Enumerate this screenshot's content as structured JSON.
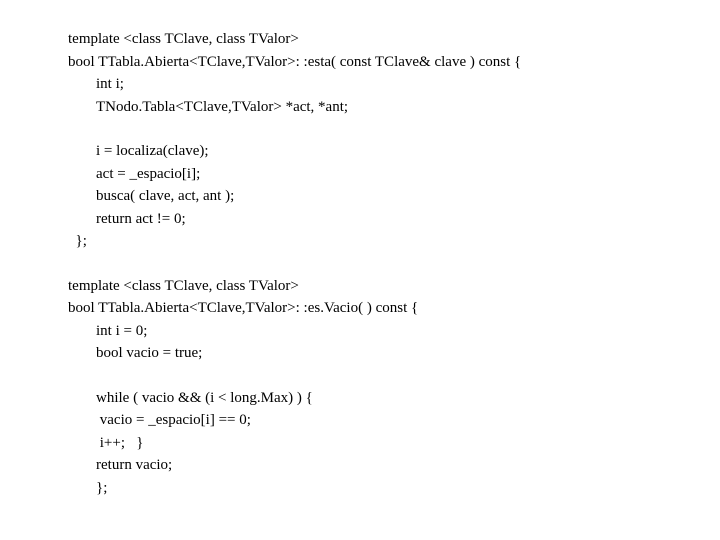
{
  "lines": {
    "l1": "template <class TClave, class TValor>",
    "l2": "bool TTabla.Abierta<TClave,TValor>: :esta( const TClave& clave ) const {",
    "l3": "int i;",
    "l4": "TNodo.Tabla<TClave,TValor> *act, *ant;",
    "l5": "i = localiza(clave);",
    "l6": "act = _espacio[i];",
    "l7": "busca( clave, act, ant );",
    "l8": "return act != 0;",
    "l9": "};",
    "l10": "template <class TClave, class TValor>",
    "l11": "bool TTabla.Abierta<TClave,TValor>: :es.Vacio( ) const {",
    "l12": "int i = 0;",
    "l13": "bool vacio = true;",
    "l14": "while ( vacio && (i < long.Max) ) {",
    "l15": " vacio = _espacio[i] == 0;",
    "l16": " i++;   }",
    "l17": "return vacio;",
    "l18": "};"
  }
}
